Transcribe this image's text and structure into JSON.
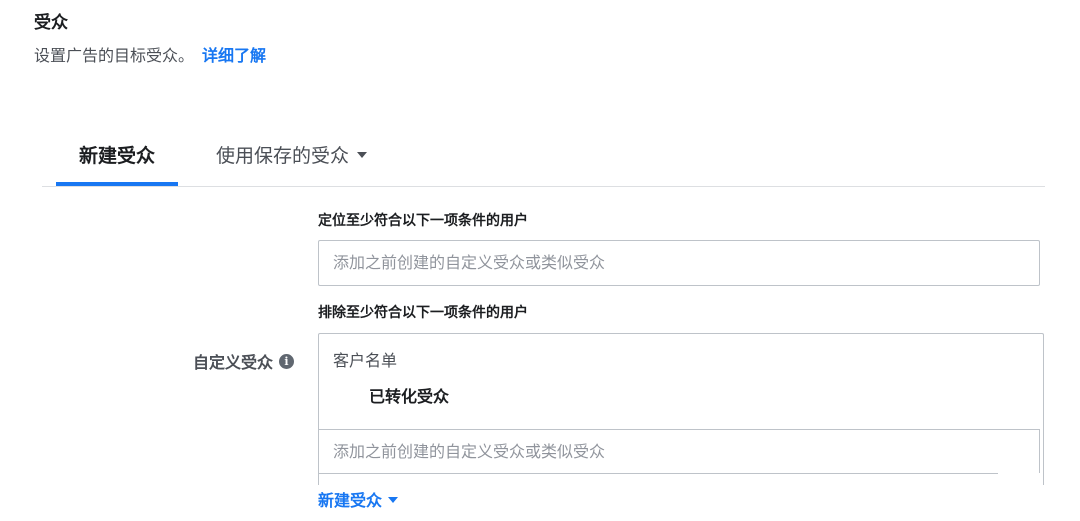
{
  "section": {
    "title": "受众",
    "description": "设置广告的目标受众。",
    "learn_more": "详细了解"
  },
  "tabs": [
    {
      "label": "新建受众",
      "active": true
    },
    {
      "label": "使用保存的受众",
      "active": false,
      "has_dropdown": true
    }
  ],
  "custom_audience": {
    "row_label": "自定义受众",
    "info_icon": "i",
    "include": {
      "label": "定位至少符合以下一项条件的用户",
      "placeholder": "添加之前创建的自定义受众或类似受众"
    },
    "exclude": {
      "label": "排除至少符合以下一项条件的用户",
      "group_title": "客户名单",
      "items": [
        "已转化受众"
      ],
      "placeholder": "添加之前创建的自定义受众或类似受众"
    },
    "create_new": "新建受众"
  },
  "colors": {
    "accent": "#1877f2",
    "text_primary": "#1c1e21",
    "text_secondary": "#4b4f56",
    "placeholder": "#90949c",
    "border": "#bec3c9"
  },
  "icons": [
    "info-icon",
    "caret-down-icon"
  ]
}
